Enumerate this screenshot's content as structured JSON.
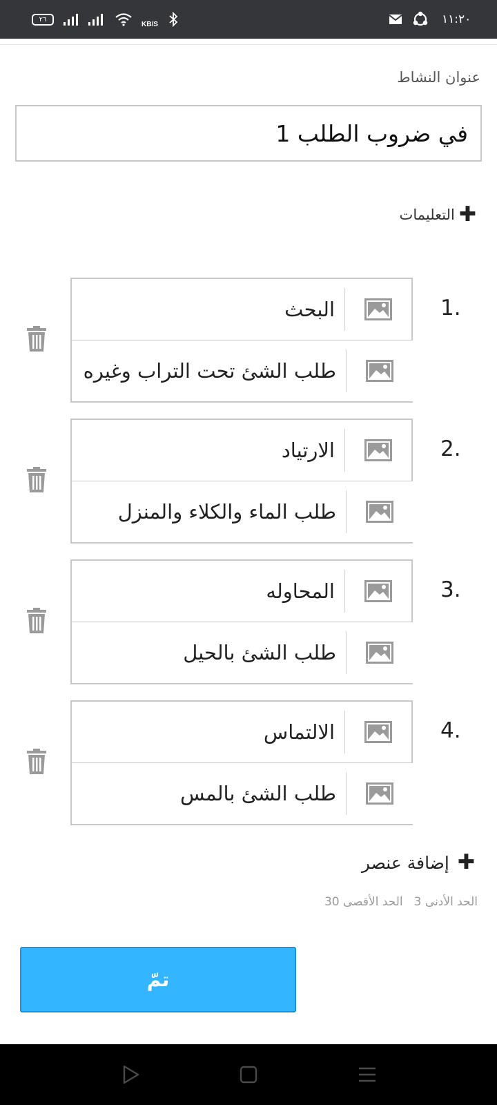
{
  "status_bar": {
    "battery": "٢٦",
    "network_speed": "KB/S",
    "time": "١١:٢٠"
  },
  "form": {
    "title_label": "عنوان النشاط",
    "title_value": "في ضروب الطلب 1",
    "instructions_label": "التعليمات"
  },
  "items": [
    {
      "number": "1.",
      "term": "البحث",
      "definition": "طلب الشئ تحت التراب وغيره"
    },
    {
      "number": "2.",
      "term": "الارتياد",
      "definition": "طلب الماء والكلاء والمنزل"
    },
    {
      "number": "3.",
      "term": "المحاوله",
      "definition": "طلب الشئ بالحيل"
    },
    {
      "number": "4.",
      "term": "الالتماس",
      "definition": "طلب الشئ بالمس"
    }
  ],
  "add_item": {
    "label": "إضافة عنصر"
  },
  "limits": {
    "min_label": "الحد الأدنى",
    "min_value": "3",
    "max_label": "الحد الأقصى",
    "max_value": "30"
  },
  "done_button": {
    "label": "تمّ"
  },
  "colors": {
    "accent": "#33b5ff",
    "status_bar": "#35363a",
    "nav_bar": "#000000",
    "icon_gray": "#9a9a9a"
  },
  "icons": [
    "battery-icon",
    "signal-icon",
    "wifi-icon",
    "bluetooth-icon",
    "mail-icon",
    "sync-icon",
    "image-icon",
    "trash-icon",
    "plus-icon",
    "nav-back-icon",
    "nav-home-icon",
    "nav-menu-icon"
  ]
}
